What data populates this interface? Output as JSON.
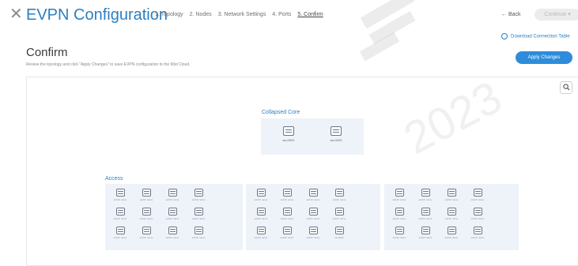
{
  "header": {
    "close_glyph": "✕",
    "title": "EVPN Configuration",
    "steps": [
      "1. Topology",
      "2. Nodes",
      "3. Network Settings",
      "4. Ports",
      "5. Confirm"
    ],
    "active_step": 4,
    "back_label": "← Back",
    "continue_label": "Continue ▾",
    "download_label": "Download Connection Table"
  },
  "page": {
    "title": "Confirm",
    "subtitle": "Review the topology and click \"Apply Changes\" to save EVPN configuration to the Mist Cloud.",
    "apply_label": "Apply Changes",
    "zoom_icon": "search-icon"
  },
  "topology": {
    "core": {
      "title": "Collapsed Core",
      "switches": [
        "sw-0001",
        "sw-0002"
      ]
    },
    "access": {
      "title": "Access",
      "groups": [
        {
          "rows": [
            [
              "switch name",
              "switch name",
              "switch name",
              "switch name"
            ],
            [
              "switch name",
              "switch name",
              "switch name",
              "switch name"
            ],
            [
              "switch name",
              "switch name",
              "switch name",
              "switch name"
            ]
          ]
        },
        {
          "rows": [
            [
              "switch name",
              "switch name",
              "switch name",
              "switch name"
            ],
            [
              "switch name",
              "switch name",
              "switch name",
              "switch name"
            ],
            [
              "switch name",
              "switch name",
              "switch name",
              "sw-0003"
            ]
          ]
        },
        {
          "rows": [
            [
              "switch name",
              "switch name",
              "switch name",
              "switch name"
            ],
            [
              "switch name",
              "switch name",
              "switch name",
              "switch name"
            ],
            [
              "switch name",
              "switch name",
              "switch name",
              "switch name"
            ]
          ]
        }
      ]
    }
  },
  "watermark": "2023",
  "colors": {
    "accent": "#2b7fc2",
    "primary_button": "#2e8cdb",
    "group_bg": "#eef2f9"
  }
}
